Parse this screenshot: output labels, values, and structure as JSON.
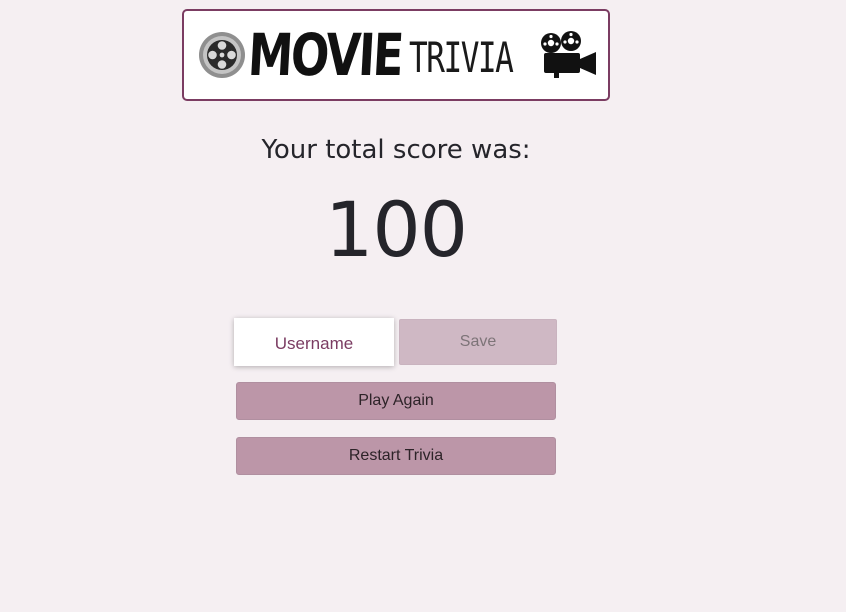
{
  "logo": {
    "word_movie": "MOVIE",
    "word_trivia": "TRIVIA",
    "left_icon": "film-reel-icon",
    "right_icon": "movie-camera-icon",
    "border_color": "#7b3c62"
  },
  "result": {
    "heading": "Your total score was:",
    "score": "100"
  },
  "save_form": {
    "username_placeholder": "Username",
    "username_value": "",
    "save_label": "Save"
  },
  "actions": {
    "play_again_label": "Play Again",
    "restart_label": "Restart Trivia"
  },
  "colors": {
    "background": "#f5eff2",
    "accent": "#7b3c62",
    "button": "#bc96a8",
    "button_disabled": "#cfb8c4"
  }
}
